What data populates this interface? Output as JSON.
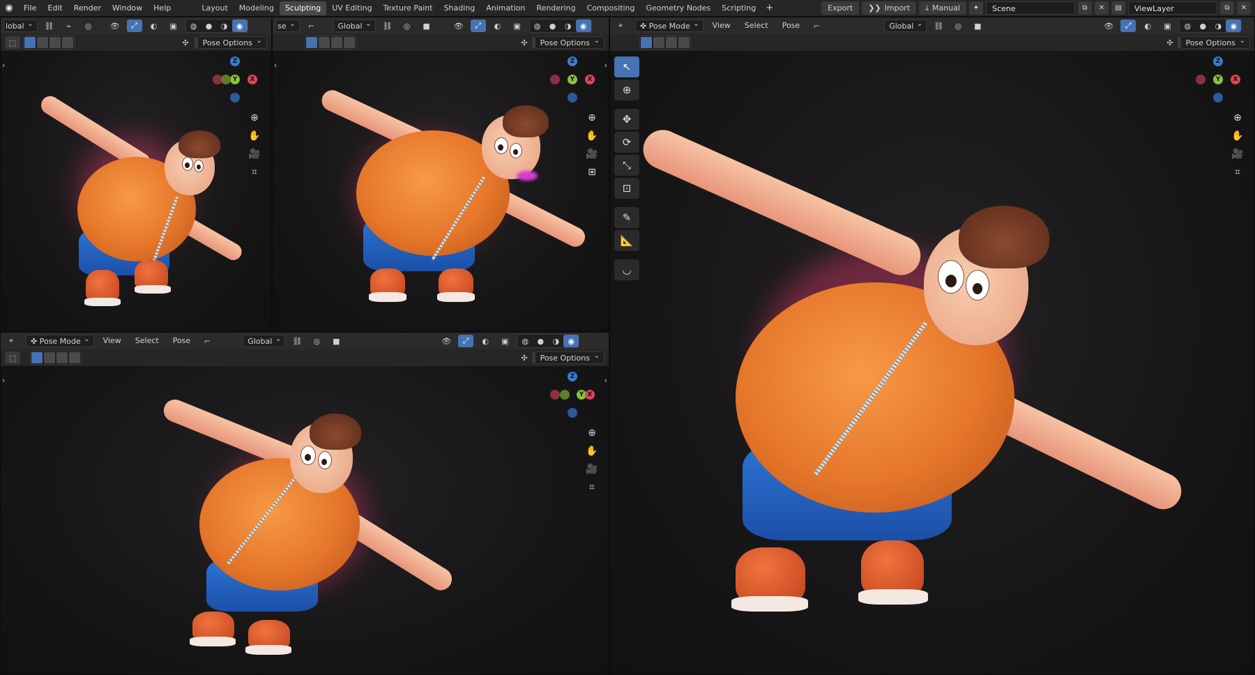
{
  "menu": [
    "File",
    "Edit",
    "Render",
    "Window",
    "Help"
  ],
  "workspaces": [
    "Layout",
    "Modeling",
    "Sculpting",
    "UV Editing",
    "Texture Paint",
    "Shading",
    "Animation",
    "Rendering",
    "Compositing",
    "Geometry Nodes",
    "Scripting"
  ],
  "active_workspace": "Sculpting",
  "topright": {
    "export": "Export",
    "import": "Import",
    "manual": "Manual",
    "scene": "Scene",
    "viewlayer": "ViewLayer"
  },
  "viewport": {
    "mode": "Pose Mode",
    "mode_partial": "se",
    "menus": [
      "View",
      "Select",
      "Pose"
    ],
    "orientation": "Global",
    "orientation_partial": "lobal",
    "pose_options": "Pose Options",
    "close": "X"
  },
  "gizmo": {
    "z": "Z",
    "y": "Y",
    "x": "X"
  },
  "icons": {
    "zoom": "zoom-icon",
    "pan": "hand-icon",
    "camera": "camera-icon",
    "grid": "grid-icon"
  }
}
